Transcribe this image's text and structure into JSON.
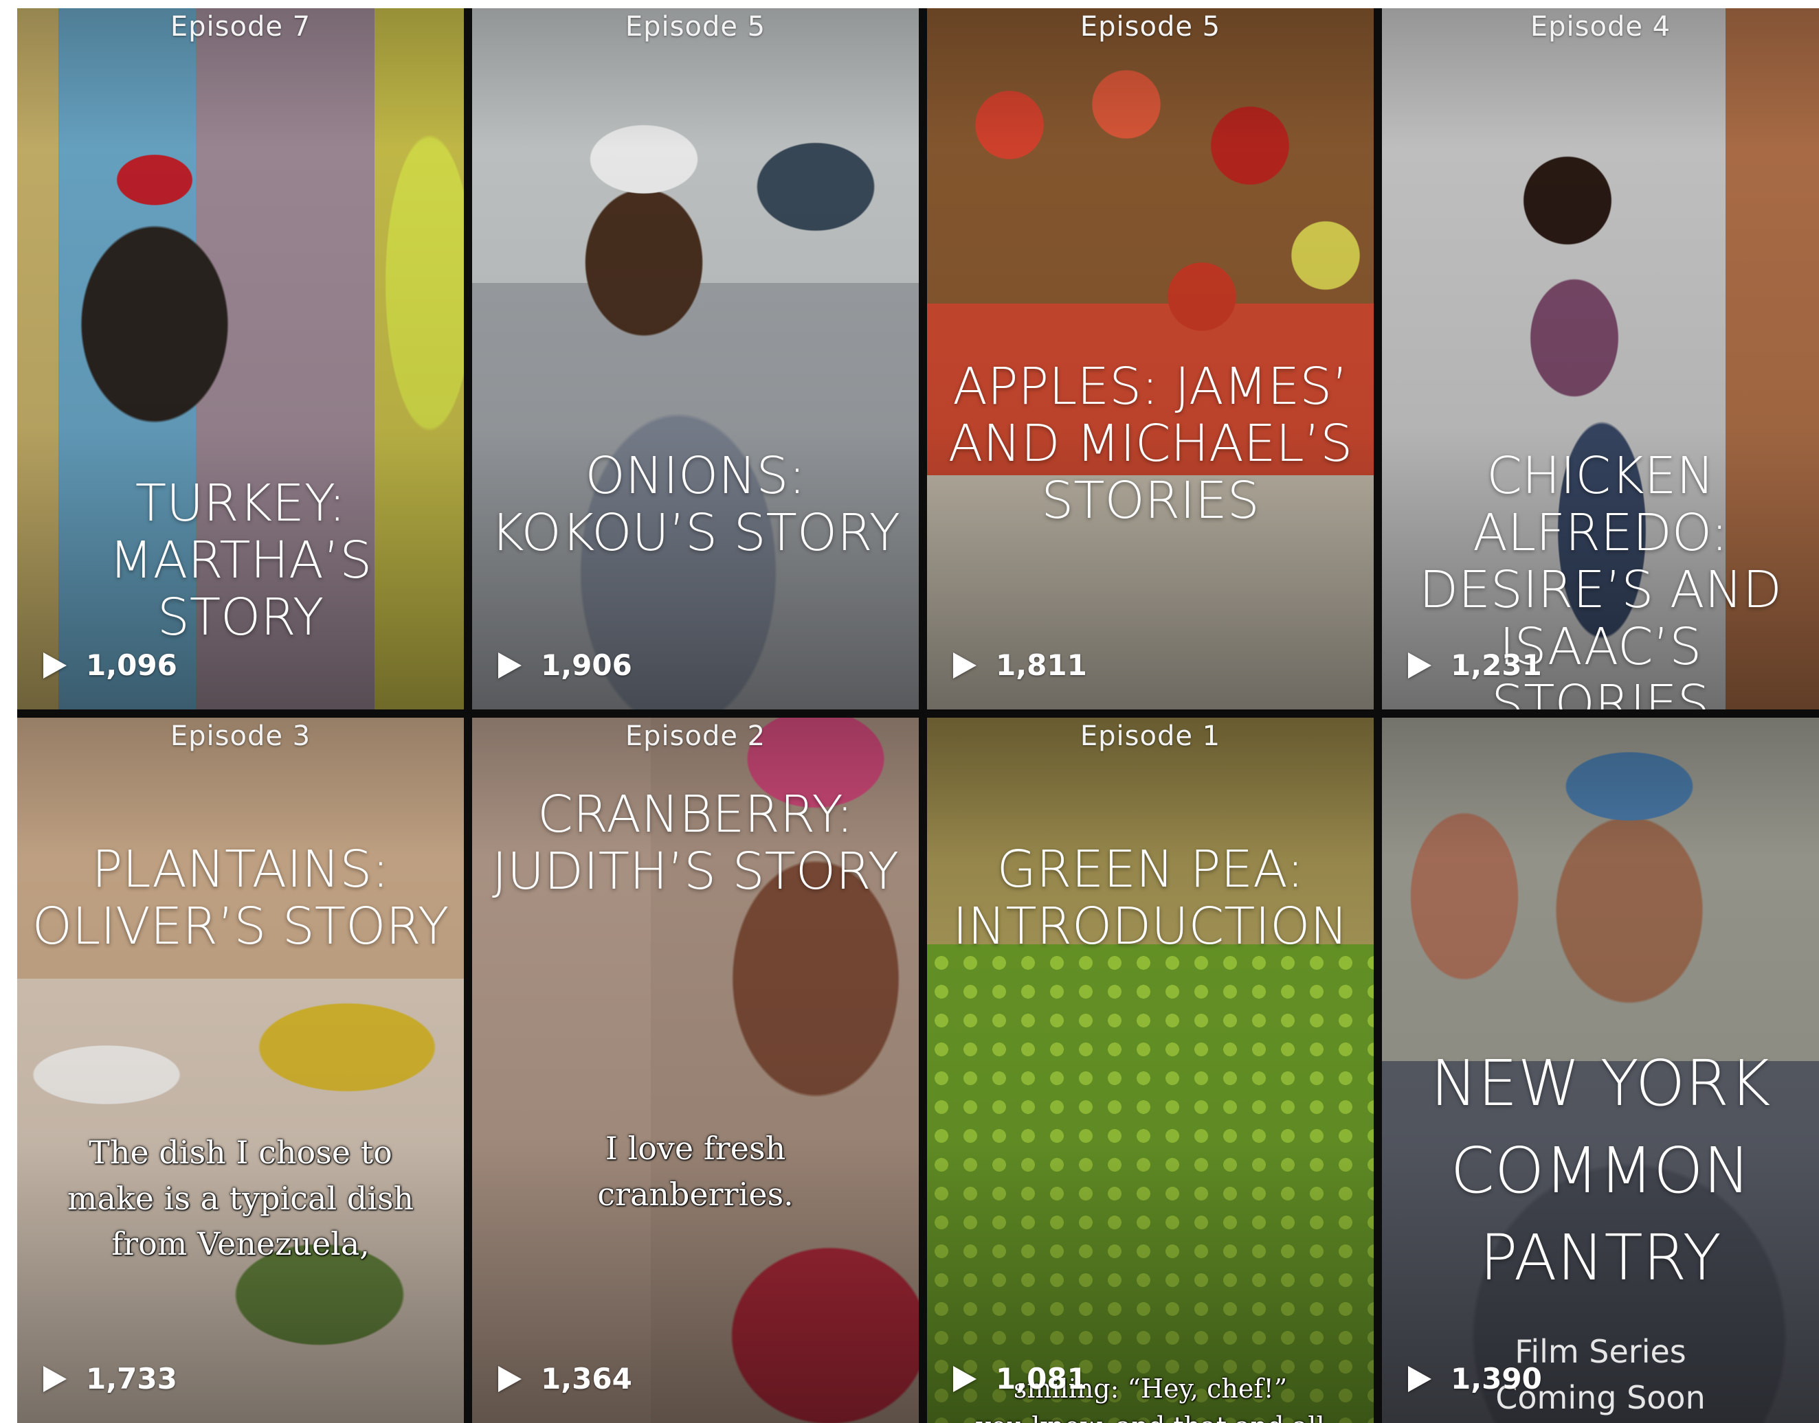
{
  "tiles": [
    {
      "episode": "Episode 7",
      "title": [
        "TURKEY:",
        "MARTHA’S STORY"
      ],
      "views": "1,096"
    },
    {
      "episode": "Episode 5",
      "title": [
        "ONIONS:",
        "KOKOU’S STORY"
      ],
      "views": "1,906"
    },
    {
      "episode": "Episode 5",
      "title": [
        "APPLES: JAMES’",
        "AND MICHAEL’S",
        "STORIES"
      ],
      "views": "1,811"
    },
    {
      "episode": "Episode 4",
      "title": [
        "CHICKEN",
        "ALFREDO:",
        "DESIRE’S AND",
        "ISAAC’S STORIES"
      ],
      "views": "1,231"
    },
    {
      "episode": "Episode 3",
      "title": [
        "PLANTAINS:",
        "OLIVER’S STORY"
      ],
      "caption": [
        "The dish I chose to",
        "make is a typical dish",
        "from Venezuela,"
      ],
      "views": "1,733"
    },
    {
      "episode": "Episode 2",
      "title": [
        "CRANBERRY:",
        "JUDITH’S STORY"
      ],
      "caption": [
        "I love fresh",
        "cranberries."
      ],
      "views": "1,364"
    },
    {
      "episode": "Episode 1",
      "title": [
        "GREEN PEA:",
        "INTRODUCTION"
      ],
      "caption": [
        "smiling: “Hey, chef!”",
        "you know, and that and all that"
      ],
      "views": "1,081"
    },
    {
      "title": [
        "NEW YORK",
        "COMMON",
        "PANTRY"
      ],
      "subtitle": [
        "Film Series",
        "Coming Soon"
      ],
      "views": "1,390"
    }
  ],
  "icons": {
    "play": "play-icon"
  }
}
